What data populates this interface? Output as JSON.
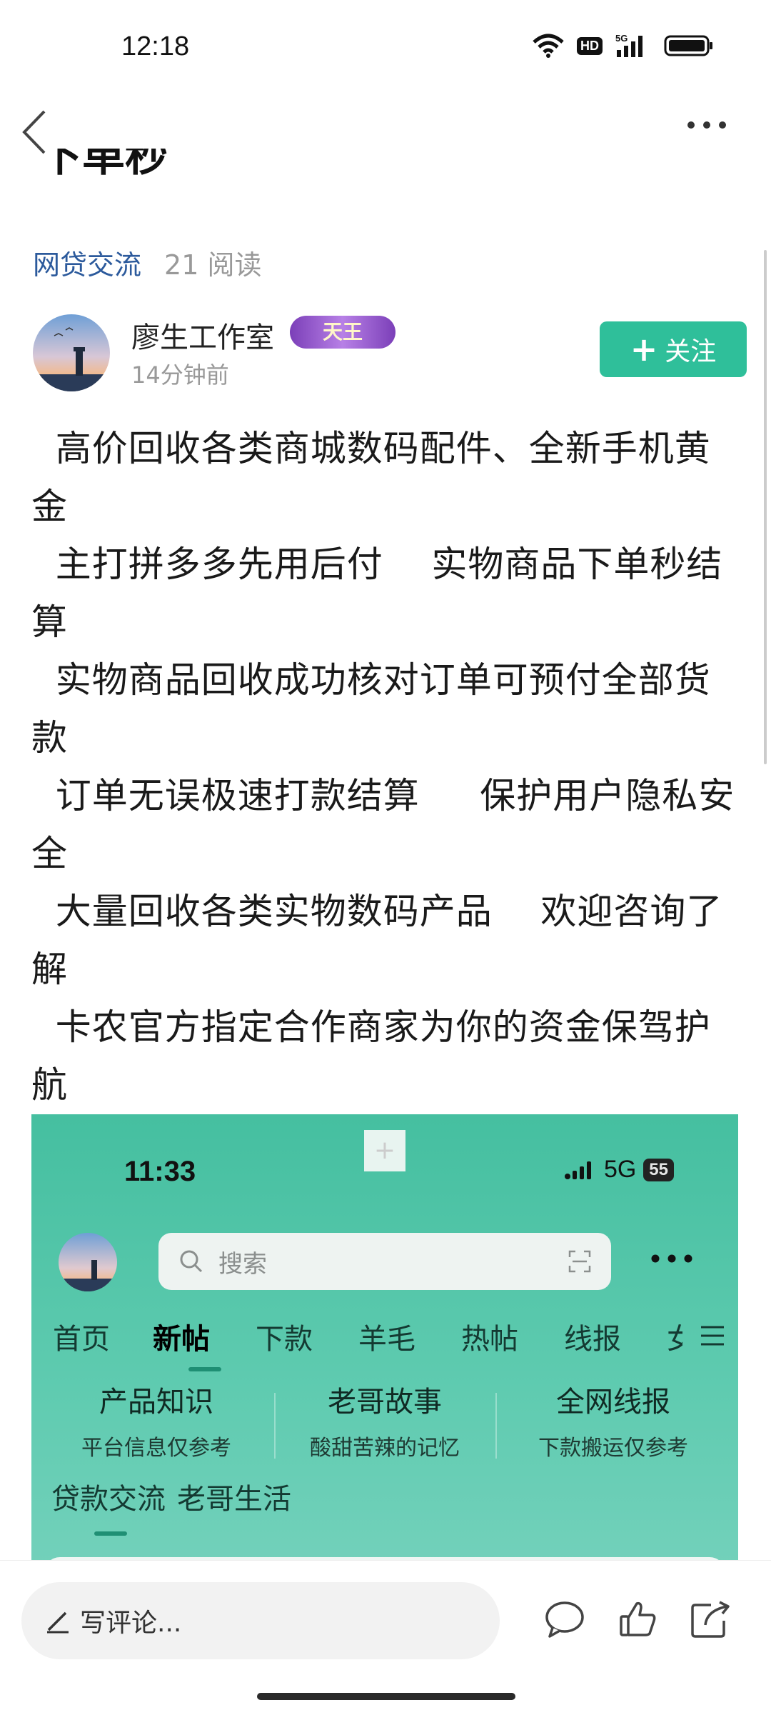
{
  "status_bar": {
    "time": "12:18",
    "hd_label": "HD",
    "network_label": "5G",
    "icons": [
      "wifi-icon",
      "hd-icon",
      "signal-5g-icon",
      "battery-icon"
    ]
  },
  "nav": {
    "back_icon": "chevron-left-icon",
    "more_icon": "more-horizontal-icon"
  },
  "post": {
    "title_partial": "下单秒",
    "category": "网贷交流",
    "reads": "21 阅读"
  },
  "author": {
    "name": "廖生工作室",
    "badge": "天王",
    "time_ago": "14分钟前",
    "follow_label": "关注"
  },
  "content": {
    "paragraphs": [
      "  高价回收各类商城数码配件、全新手机黄金",
      "  主打拼多多先用后付    实物商品下单秒结算",
      "  实物商品回收成功核对订单可预付全部货款",
      "  订单无误极速打款结算     保护用户隐私安全",
      "  大量回收各类实物数码产品    欢迎咨询了解",
      "  卡农官方指定合作商家为你的资金保驾护航"
    ]
  },
  "embedded_screenshot": {
    "time": "11:33",
    "network": "5G",
    "battery": "55",
    "search_placeholder": "搜索",
    "tabs": [
      "首页",
      "新帖",
      "下款",
      "羊毛",
      "热帖",
      "线报",
      "女"
    ],
    "active_tab": "新帖",
    "categories": [
      {
        "title": "产品知识",
        "subtitle": "平台信息仅参考"
      },
      {
        "title": "老哥故事",
        "subtitle": "酸甜苦辣的记忆"
      },
      {
        "title": "全网线报",
        "subtitle": "下款搬运仅参考"
      }
    ],
    "bottom_tabs": [
      "贷款交流",
      "老哥生活"
    ]
  },
  "bottom_bar": {
    "comment_placeholder": "写评论...",
    "icons": [
      "comment-icon",
      "like-icon",
      "share-icon"
    ]
  },
  "colors": {
    "accent": "#2fbf9a",
    "category_link": "#2c5a9c",
    "embed_bg": "#45bfa0"
  }
}
